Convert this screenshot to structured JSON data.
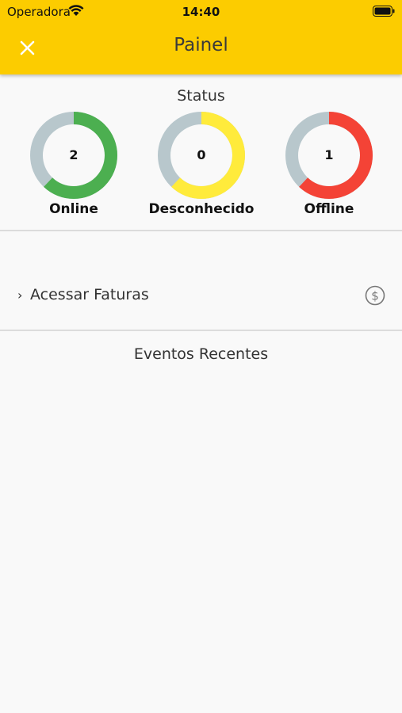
{
  "status_bar": {
    "carrier": "Operadora",
    "time": "14:40"
  },
  "app_bar": {
    "title": "Painel",
    "close_icon": "close-icon"
  },
  "status_section": {
    "title": "Status",
    "gauges": [
      {
        "label": "Online",
        "value": "2",
        "color": "#4caf50",
        "fraction": 0.62
      },
      {
        "label": "Desconhecido",
        "value": "0",
        "color": "#ffeb3b",
        "fraction": 0.62
      },
      {
        "label": "Offline",
        "value": "1",
        "color": "#f44336",
        "fraction": 0.62
      }
    ],
    "track_color": "#b8c7cc"
  },
  "menu": {
    "faturas_label": "Acessar Faturas",
    "faturas_icon": "dollar-circle-icon"
  },
  "events": {
    "title": "Eventos Recentes"
  },
  "colors": {
    "accent": "#fccc00",
    "background": "#f9f9f9"
  }
}
